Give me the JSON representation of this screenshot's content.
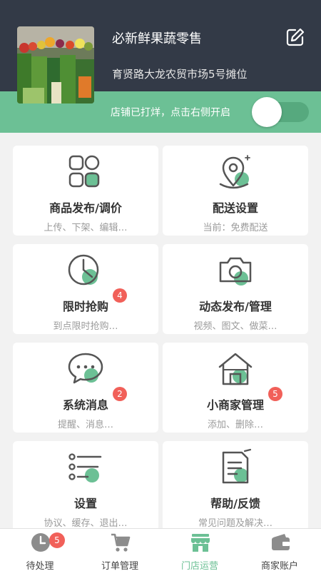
{
  "store": {
    "name": "必新鲜果蔬零售",
    "address": "育贤路大龙农贸市场5号摊位",
    "status_text": "店铺已打烊，点击右侧开启",
    "open": false
  },
  "colors": {
    "header": "#333a47",
    "accent": "#6cc095",
    "badge": "#f16059"
  },
  "cards": [
    {
      "title": "商品发布/调价",
      "subtitle": "上传、下架、编辑…",
      "badge": null,
      "icon": "grid-icon"
    },
    {
      "title": "配送设置",
      "subtitle": "当前：免费配送",
      "badge": null,
      "icon": "location-pin-icon"
    },
    {
      "title": "限时抢购",
      "subtitle": "到点限时抢购…",
      "badge": "4",
      "icon": "clock-icon"
    },
    {
      "title": "动态发布/管理",
      "subtitle": "视频、图文、做菜…",
      "badge": null,
      "icon": "camera-icon"
    },
    {
      "title": "系统消息",
      "subtitle": "提醒、消息…",
      "badge": "2",
      "icon": "chat-bubble-icon"
    },
    {
      "title": "小商家管理",
      "subtitle": "添加、删除…",
      "badge": "5",
      "icon": "shop-house-icon"
    },
    {
      "title": "设置",
      "subtitle": "协议、缓存、退出…",
      "badge": null,
      "icon": "settings-list-icon"
    },
    {
      "title": "帮助/反馈",
      "subtitle": "常见问题及解决…",
      "badge": null,
      "icon": "help-document-icon"
    }
  ],
  "tabs": [
    {
      "label": "待处理",
      "badge": "5",
      "icon": "clock-icon"
    },
    {
      "label": "订单管理",
      "badge": null,
      "icon": "cart-icon"
    },
    {
      "label": "门店运营",
      "badge": null,
      "icon": "store-icon",
      "active": true
    },
    {
      "label": "商家账户",
      "badge": null,
      "icon": "wallet-icon"
    }
  ]
}
